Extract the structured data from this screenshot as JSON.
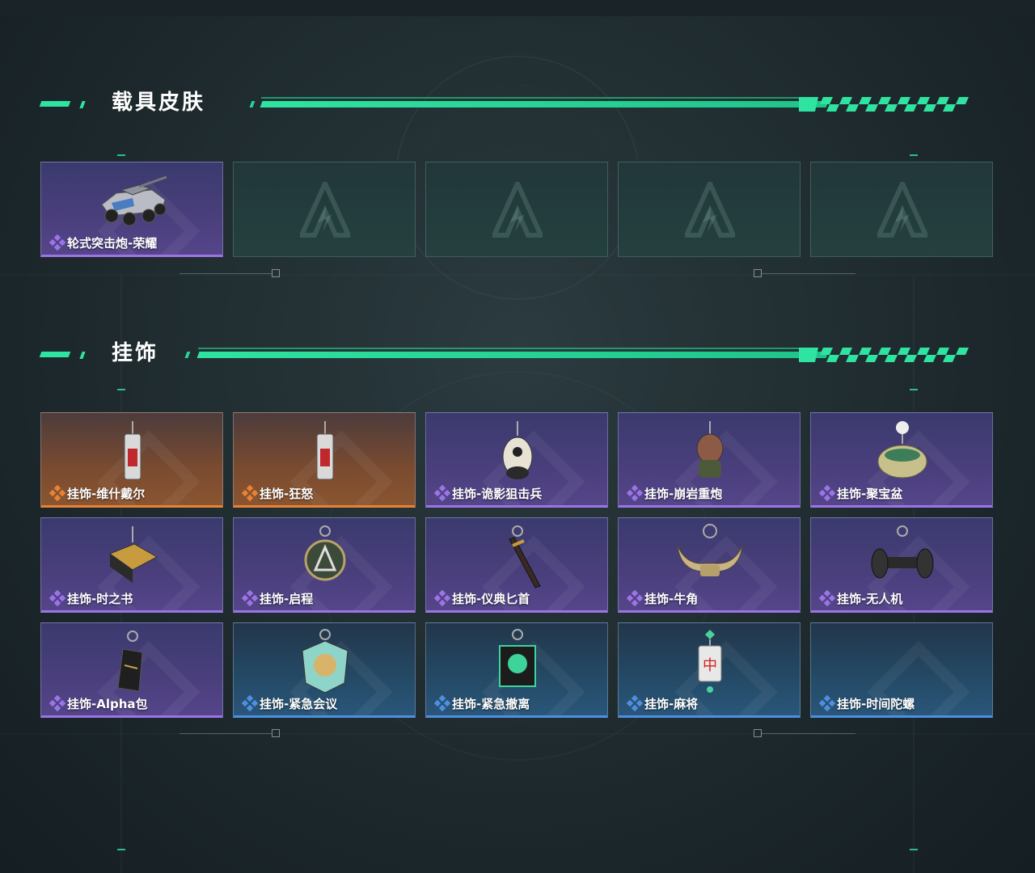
{
  "sections": [
    {
      "title": "载具皮肤",
      "cards": [
        {
          "label": "轮式突击炮-荣耀",
          "rarity": "purple",
          "icon": "armored-vehicle-icon"
        },
        {
          "label": "",
          "rarity": "empty",
          "icon": "placeholder-logo-icon"
        },
        {
          "label": "",
          "rarity": "empty",
          "icon": "placeholder-logo-icon"
        },
        {
          "label": "",
          "rarity": "empty",
          "icon": "placeholder-logo-icon"
        },
        {
          "label": "",
          "rarity": "empty",
          "icon": "placeholder-logo-icon"
        }
      ]
    },
    {
      "title": "挂饰",
      "cards": [
        {
          "label": "挂饰-维什戴尔",
          "rarity": "orange",
          "icon": "keychain-charm-icon"
        },
        {
          "label": "挂饰-狂怒",
          "rarity": "orange",
          "icon": "keychain-charm-icon"
        },
        {
          "label": "挂饰-诡影狙击兵",
          "rarity": "purple",
          "icon": "bird-charm-icon"
        },
        {
          "label": "挂饰-崩岩重炮",
          "rarity": "purple",
          "icon": "figure-charm-icon"
        },
        {
          "label": "挂饰-聚宝盆",
          "rarity": "purple",
          "icon": "treasure-bowl-charm-icon"
        },
        {
          "label": "挂饰-时之书",
          "rarity": "purple",
          "icon": "book-charm-icon"
        },
        {
          "label": "挂饰-启程",
          "rarity": "purple",
          "icon": "medallion-charm-icon"
        },
        {
          "label": "挂饰-仪典匕首",
          "rarity": "purple",
          "icon": "dagger-charm-icon"
        },
        {
          "label": "挂饰-牛角",
          "rarity": "purple",
          "icon": "horns-charm-icon"
        },
        {
          "label": "挂饰-无人机",
          "rarity": "purple",
          "icon": "drone-charm-icon"
        },
        {
          "label": "挂饰-Alpha包",
          "rarity": "purple",
          "icon": "pouch-charm-icon"
        },
        {
          "label": "挂饰-紧急会议",
          "rarity": "blue",
          "icon": "badge-charm-icon"
        },
        {
          "label": "挂饰-紧急撤离",
          "rarity": "blue",
          "icon": "skull-tag-charm-icon"
        },
        {
          "label": "挂饰-麻将",
          "rarity": "blue",
          "icon": "mahjong-tile-charm-icon"
        },
        {
          "label": "挂饰-时间陀螺",
          "rarity": "blue",
          "icon": "empty-art-icon"
        }
      ]
    }
  ],
  "colors": {
    "accent": "#2fe3a0",
    "purple": "#9b74e6",
    "orange": "#e88235",
    "blue": "#4d8fe0"
  }
}
